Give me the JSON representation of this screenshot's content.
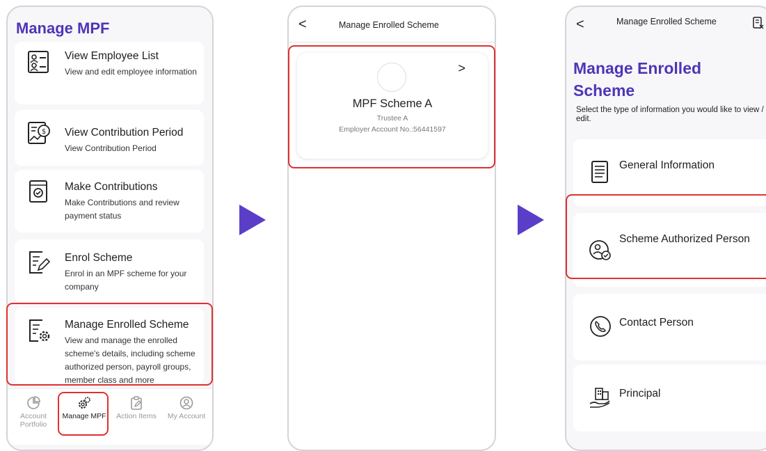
{
  "screen1": {
    "title": "Manage MPF",
    "cards": [
      {
        "title": "View Employee List",
        "desc": "View and edit employee information"
      },
      {
        "title": "View Contribution Period",
        "desc": "View Contribution Period"
      },
      {
        "title": "Make Contributions",
        "desc": "Make Contributions and review payment status"
      },
      {
        "title": "Enrol Scheme",
        "desc": "Enrol in an MPF scheme for your company"
      },
      {
        "title": "Manage Enrolled Scheme",
        "desc": "View and manage the enrolled scheme's details, including scheme authorized person, payroll groups, member class and more"
      }
    ],
    "nav": {
      "account_portfolio": "Account Portfolio",
      "manage_mpf": "Manage MPF",
      "action_items": "Action Items",
      "my_account": "My Account"
    }
  },
  "screen2": {
    "back": "<",
    "title": "Manage Enrolled Scheme",
    "scheme": {
      "name": "MPF Scheme A",
      "trustee": "Trustee A",
      "account": "Employer Account No.:56441597",
      "chevron": ">"
    }
  },
  "screen3": {
    "back": "<",
    "title": "Manage Enrolled Scheme",
    "heading": "Manage Enrolled Scheme",
    "desc": "Select the type of information you would like to view / edit.",
    "options": [
      {
        "label": "General Information",
        "icon": "document-icon"
      },
      {
        "label": "Scheme Authorized Person",
        "icon": "authorized-person-icon"
      },
      {
        "label": "Contact Person",
        "icon": "phone-icon"
      },
      {
        "label": "Principal",
        "icon": "building-hand-icon"
      }
    ]
  },
  "colors": {
    "accent": "#4f35b8",
    "arrow": "#5a3ec8",
    "highlight": "#e03030"
  }
}
